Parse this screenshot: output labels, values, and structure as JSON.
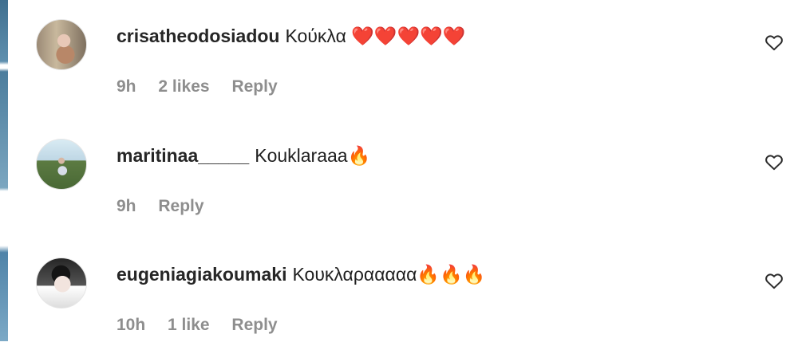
{
  "comments": [
    {
      "username": "crisatheodosiadou",
      "text": "Κούκλα ❤️❤️❤️❤️❤️",
      "time": "9h",
      "likes": "2 likes",
      "reply": "Reply"
    },
    {
      "username": "maritinaa_____",
      "text": "Kouklaraaa🔥",
      "time": "9h",
      "reply": "Reply"
    },
    {
      "username": "eugeniagiakoumaki",
      "text": "Κουκλαρααααα🔥🔥🔥",
      "time": "10h",
      "likes": "1 like",
      "reply": "Reply"
    }
  ],
  "icons": {
    "like": "heart-outline-icon"
  }
}
